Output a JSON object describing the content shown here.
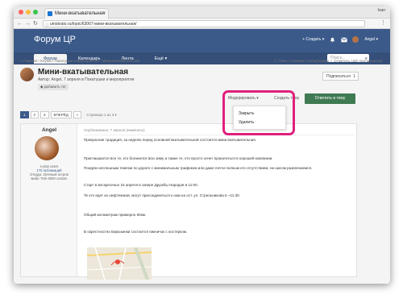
{
  "browser": {
    "tab_title": "Мини-вкатывательная",
    "user": "Ivan",
    "url": "umskrato.ru/topic/63067-мини-вкатывательная/"
  },
  "site": {
    "logo": "Форум ЦР",
    "create_label": "+ Создать ▾",
    "user_label": "Angel ▾",
    "nav": [
      "Форум",
      "Календарь",
      "Лента",
      "Ещё ▾"
    ],
    "search_placeholder": "Поиск...",
    "breadcrumbs": "⌂ Главная › Клубы › Покатушки и мероприятия › Мини-вкатывательная",
    "unread_links": "☐ Темы с новыми сообщениями   ✓ Отметить сайт прочитанным"
  },
  "topic": {
    "title": "Мини-вкатывательная",
    "author_line": "Автор: Angel, 7 апреля в Покатушки и мероприятия",
    "badge": "◆ Добавить тег",
    "follow_label": "Подписаться",
    "follow_count": "1"
  },
  "actions": {
    "moderate": "Модерировать ▾",
    "create_topic": "Создать тему",
    "reply": "Ответить в тему",
    "dropdown": [
      "Закрыть",
      "Удалить"
    ]
  },
  "pager": {
    "pages": [
      "1",
      "2",
      "3"
    ],
    "next": "ВПЕРЁД",
    "last": "»",
    "label": "Страница 1 из 3 ▾"
  },
  "post": {
    "author": "Angel",
    "author_info": [
      "e-plus users",
      "175 публикаций",
      "Откуда: Зелёный остров",
      "Байк: Trek 6000 custom"
    ],
    "posted": "Опубликовано: 7 апреля (изменено)",
    "lines": [
      "Прекрасная традиция, за неделю перед основной вкатывательной состоится мини вкатывательная.",
      "Приглашаются все те, кто боганился всю зиму и также те, кто просто хочет прокатиться в хорошей компании.",
      "Поедем неспешным темпом по дороге с минимальным трафиком или даже почти полным его отсутствием, ни шагом развлекаемся.",
      "Старт в воскресенье 15 апреля в сквере Дружбы Народов в 11:00.",
      "Те кто едет из нефтяников, могут присоединяться к нам на ост. ул. Стрельникова в ~11:30.",
      "Общий километраж примерно 50км.",
      "В окрестностях Бирюзинки состоится пикничок с костерком."
    ]
  }
}
